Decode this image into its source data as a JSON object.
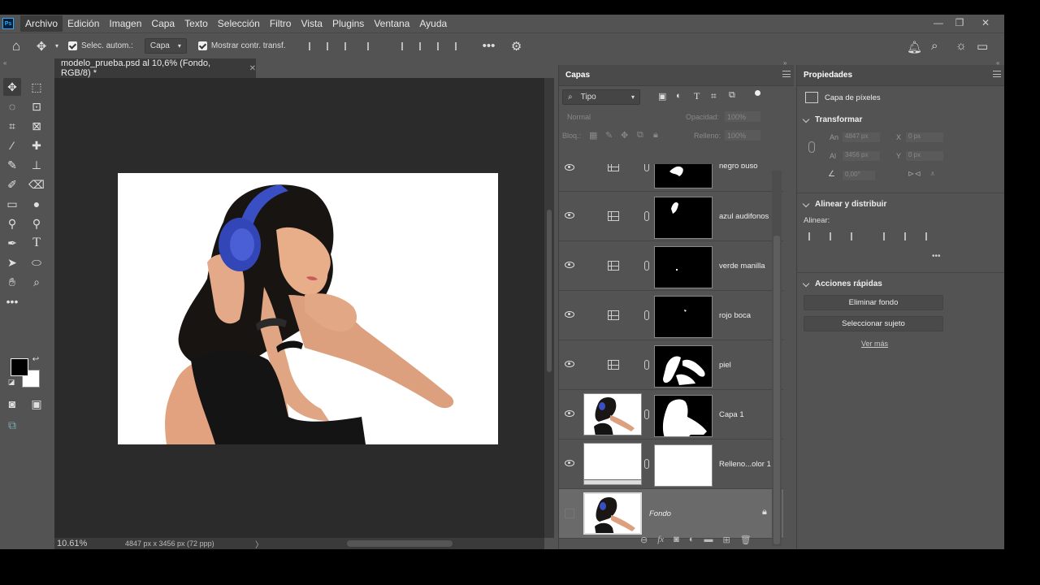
{
  "menu": {
    "items": [
      "Archivo",
      "Edición",
      "Imagen",
      "Capa",
      "Texto",
      "Selección",
      "Filtro",
      "Vista",
      "Plugins",
      "Ventana",
      "Ayuda"
    ],
    "app_badge": "Ps"
  },
  "options": {
    "auto_select_label": "Selec. autom.:",
    "auto_select_target": "Capa",
    "show_transform_label": "Mostrar contr. transf."
  },
  "document": {
    "tab_title": "modelo_prueba.psd al 10,6% (Fondo, RGB/8) *",
    "zoom": "10.61%",
    "dimensions": "4847 px x 3456 px (72 ppp)"
  },
  "layers_panel": {
    "title": "Capas",
    "filter_label": "Tipo",
    "blend_mode": "Normal",
    "opacity_label": "Opacidad:",
    "opacity_value": "100%",
    "lock_label": "Bloq.:",
    "fill_label": "Relleno:",
    "fill_value": "100%",
    "layers": [
      {
        "name": "negro buso",
        "type": "adjustment"
      },
      {
        "name": "azul audifonos",
        "type": "adjustment"
      },
      {
        "name": "verde manilla",
        "type": "adjustment"
      },
      {
        "name": "rojo boca",
        "type": "adjustment"
      },
      {
        "name": "piel",
        "type": "adjustment"
      },
      {
        "name": "Capa 1",
        "type": "pixel"
      },
      {
        "name": "Relleno...olor 1",
        "type": "fill"
      },
      {
        "name": "Fondo",
        "type": "background",
        "selected": true
      }
    ]
  },
  "properties_panel": {
    "title": "Propiedades",
    "layer_kind": "Capa de píxeles",
    "transform_title": "Transformar",
    "width_label": "An",
    "width_value": "4847 px",
    "height_label": "Al",
    "height_value": "3456 px",
    "x_label": "X",
    "x_value": "0 px",
    "y_label": "Y",
    "y_value": "0 px",
    "angle_value": "0,00°",
    "align_title": "Alinear y distribuir",
    "align_label": "Alinear:",
    "quick_title": "Acciones rápidas",
    "remove_bg": "Eliminar fondo",
    "select_subject": "Seleccionar sujeto",
    "see_more": "Ver más"
  },
  "colors": {
    "foreground": "#000000",
    "background": "#ffffff",
    "ui_bg": "#535353",
    "canvas_bg": "#2b2b2b",
    "headphones": "#3a4fc4"
  }
}
